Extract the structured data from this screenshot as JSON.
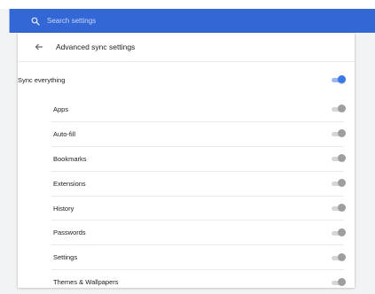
{
  "search": {
    "placeholder": "Search settings",
    "icon": "search-icon"
  },
  "page": {
    "title": "Advanced sync settings",
    "back_icon": "back-arrow-icon"
  },
  "sync_everything": {
    "label": "Sync everything",
    "enabled": true
  },
  "items": [
    {
      "label": "Apps",
      "enabled": true
    },
    {
      "label": "Auto-fill",
      "enabled": true
    },
    {
      "label": "Bookmarks",
      "enabled": true
    },
    {
      "label": "Extensions",
      "enabled": true
    },
    {
      "label": "History",
      "enabled": true
    },
    {
      "label": "Passwords",
      "enabled": true
    },
    {
      "label": "Settings",
      "enabled": true
    },
    {
      "label": "Themes & Wallpapers",
      "enabled": true
    }
  ],
  "colors": {
    "header": "#3367d6",
    "accent": "#3b78e7",
    "disabled_knob": "#9e9e9e"
  }
}
